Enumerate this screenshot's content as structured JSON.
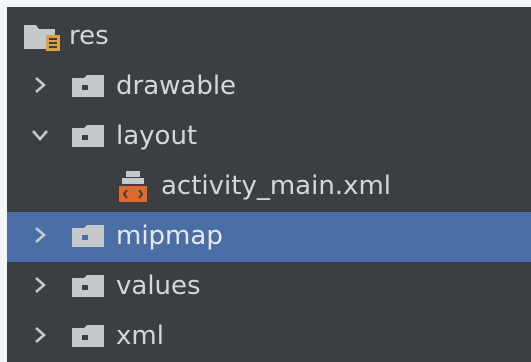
{
  "tree": {
    "root": {
      "label": "res",
      "icon": "resource-folder-icon",
      "expanded": true
    },
    "items": [
      {
        "label": "drawable",
        "icon": "folder-icon",
        "chevron": "chevron-right-icon",
        "expanded": false,
        "selected": false
      },
      {
        "label": "layout",
        "icon": "folder-icon",
        "chevron": "chevron-down-icon",
        "expanded": true,
        "selected": false,
        "children": [
          {
            "label": "activity_main.xml",
            "icon": "layout-xml-file-icon"
          }
        ]
      },
      {
        "label": "mipmap",
        "icon": "folder-icon",
        "chevron": "chevron-right-icon",
        "expanded": false,
        "selected": true
      },
      {
        "label": "values",
        "icon": "folder-icon",
        "chevron": "chevron-right-icon",
        "expanded": false,
        "selected": false
      },
      {
        "label": "xml",
        "icon": "folder-icon",
        "chevron": "chevron-right-icon",
        "expanded": false,
        "selected": false
      }
    ]
  },
  "colors": {
    "panel_background": "#3c3f41",
    "selection": "#4a6ea6",
    "text": "#d4d6d8",
    "folder_icon": "#c6c9cc",
    "resource_badge": "#d9a343",
    "xml_icon": "#e0692b"
  }
}
